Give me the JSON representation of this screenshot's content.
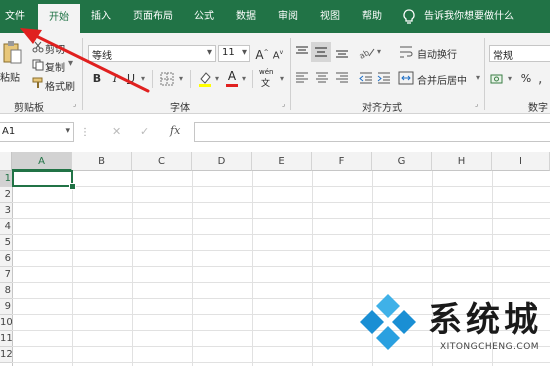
{
  "menu": {
    "tabs": [
      "文件",
      "开始",
      "插入",
      "页面布局",
      "公式",
      "数据",
      "审阅",
      "视图",
      "帮助"
    ],
    "tell_me": "告诉我你想要做什么"
  },
  "clipboard": {
    "cut": "剪切",
    "paste": "粘贴",
    "copy": "复制",
    "format_painter": "格式刷",
    "label": "剪贴板"
  },
  "font": {
    "family": "等线",
    "size": "11",
    "grow": "A",
    "shrink": "A",
    "bold": "B",
    "italic": "I",
    "underline": "U",
    "font_color_glyph": "A",
    "phonetic": "wén",
    "label": "字体"
  },
  "alignment": {
    "wrap_text": "自动换行",
    "merge_center": "合并后居中",
    "label": "对齐方式"
  },
  "number": {
    "format": "常规",
    "percent": "%",
    "label": "数字"
  },
  "formula_bar": {
    "name_box": "A1",
    "fx": "fx"
  },
  "grid": {
    "columns": [
      "A",
      "B",
      "C",
      "D",
      "E",
      "F",
      "G",
      "H",
      "I"
    ],
    "rows": [
      "1",
      "2",
      "3",
      "4",
      "5",
      "6",
      "7",
      "8",
      "9",
      "10",
      "11",
      "12"
    ]
  },
  "watermark": {
    "text": "系统城",
    "url": "XITONGCHENG.COM"
  },
  "colors": {
    "excel_green": "#217346",
    "annotation_red": "#e0201f",
    "watermark_blue": "#1a8fd4"
  }
}
